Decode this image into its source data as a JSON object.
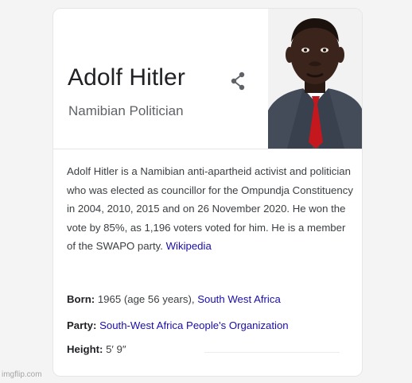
{
  "panel": {
    "title": "Adolf Hitler",
    "subtitle": "Namibian Politician",
    "description": "Adolf Hitler is a Namibian anti-apartheid activist and politician who was elected as councillor for the Ompundja Constituency in 2004, 2010, 2015 and on 26 November 2020. He won the vote by 85%, as 1,196 voters voted for him. He is a member of the SWAPO party.",
    "source_link": "Wikipedia",
    "facts": {
      "born_label": "Born:",
      "born_value": " 1965 (age 56 years), ",
      "born_link": "South West Africa",
      "party_label": "Party:",
      "party_link": "South-West Africa People's Organization",
      "height_label": "Height:",
      "height_value": " 5′ 9″"
    },
    "icons": {
      "share": "share-icon"
    },
    "colors": {
      "title": "#202124",
      "subtitle": "#5f6368",
      "link": "#1a0dab",
      "tie": "#c4171e"
    }
  },
  "watermark": "imgflip.com"
}
